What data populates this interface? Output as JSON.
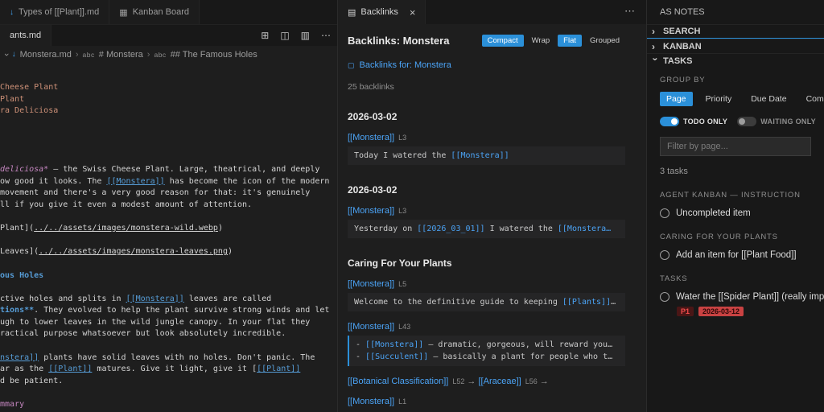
{
  "colors": {
    "accent_blue": "#2b90d9",
    "panel_link_blue": "#4ba3f5",
    "editor_link_blue": "#569cd6",
    "string_orange": "#ce9178",
    "emphasis_pink": "#c586c0",
    "priority_red": "#f14c4c",
    "due_badge_red": "#c94242"
  },
  "icons": {
    "markdown": "↓",
    "board": "▦",
    "backlinks": "▤",
    "note": "▢",
    "close": "×",
    "more": "⋯",
    "chevron": "›",
    "arrow": "→"
  },
  "editor": {
    "tabs_top": [
      {
        "label": "Types of [[Plant]].md",
        "icon": "markdown"
      },
      {
        "label": "Kanban Board",
        "icon": "board"
      }
    ],
    "tab_bottom": "ants.md",
    "actions": [
      {
        "name": "layout-grid-icon",
        "glyph": "⊞"
      },
      {
        "name": "split-editor-icon",
        "glyph": "◫"
      },
      {
        "name": "toggle-panel-icon",
        "glyph": "▥"
      },
      {
        "name": "more-actions-icon",
        "glyph": "⋯"
      }
    ],
    "breadcrumb": {
      "file": "Monstera.md",
      "abc": "abc",
      "symbol1": "# Monstera",
      "symbol2": "## The Famous Holes"
    },
    "lines": [
      {
        "seg": [
          {
            "t": "Cheese Plant",
            "c": "str"
          }
        ]
      },
      {
        "seg": [
          {
            "t": "Plant",
            "c": "str"
          }
        ]
      },
      {
        "seg": [
          {
            "t": "ra Deliciosa",
            "c": "str"
          }
        ]
      },
      {
        "seg": []
      },
      {
        "seg": []
      },
      {
        "seg": []
      },
      {
        "seg": []
      },
      {
        "seg": [
          {
            "t": "deliciosa*",
            "c": "em"
          },
          {
            "t": " — the Swiss Cheese Plant. Large, theatrical, and deeply",
            "c": "txt"
          }
        ]
      },
      {
        "seg": [
          {
            "t": "ow good it looks. The ",
            "c": "txt"
          },
          {
            "t": "[[Monstera]]",
            "c": "link"
          },
          {
            "t": " has become the icon of the modern",
            "c": "txt"
          }
        ]
      },
      {
        "seg": [
          {
            "t": "movement and there's a very good reason for that: it's genuinely",
            "c": "txt"
          }
        ]
      },
      {
        "seg": [
          {
            "t": "ll if you give it even a modest amount of attention.",
            "c": "txt"
          }
        ]
      },
      {
        "seg": []
      },
      {
        "seg": [
          {
            "t": "Plant](",
            "c": "txt"
          },
          {
            "t": "../../assets/images/monstera-wild.webp",
            "c": "url"
          },
          {
            "t": ")",
            "c": "txt"
          }
        ]
      },
      {
        "seg": []
      },
      {
        "seg": [
          {
            "t": "Leaves](",
            "c": "txt"
          },
          {
            "t": "../../assets/images/monstera-leaves.png",
            "c": "url"
          },
          {
            "t": ")",
            "c": "txt"
          }
        ]
      },
      {
        "seg": []
      },
      {
        "seg": [
          {
            "t": "ous Holes",
            "c": "head"
          }
        ]
      },
      {
        "seg": []
      },
      {
        "seg": [
          {
            "t": "ctive holes and splits in ",
            "c": "txt"
          },
          {
            "t": "[[Monstera]]",
            "c": "link"
          },
          {
            "t": " leaves are called",
            "c": "txt"
          }
        ]
      },
      {
        "seg": [
          {
            "t": "tions**",
            "c": "bold"
          },
          {
            "t": ". They evolved to help the plant survive strong winds and let",
            "c": "txt"
          }
        ]
      },
      {
        "seg": [
          {
            "t": "ugh to lower leaves in the wild jungle canopy. In your flat they",
            "c": "txt"
          }
        ]
      },
      {
        "seg": [
          {
            "t": "ractical purpose whatsoever but look absolutely incredible.",
            "c": "txt"
          }
        ]
      },
      {
        "seg": []
      },
      {
        "seg": [
          {
            "t": "nstera]]",
            "c": "link"
          },
          {
            "t": " plants have solid leaves with no holes. Don't panic. The",
            "c": "txt"
          }
        ]
      },
      {
        "seg": [
          {
            "t": "ar as the ",
            "c": "txt"
          },
          {
            "t": "[[Plant]]",
            "c": "link"
          },
          {
            "t": " matures. Give it light, give it ",
            "c": "txt"
          },
          {
            "t": "[",
            "c": "txt"
          },
          {
            "t": "[[Plant]]",
            "c": "link"
          }
        ]
      },
      {
        "seg": [
          {
            "t": "d be patient.",
            "c": "txt"
          }
        ]
      },
      {
        "seg": []
      },
      {
        "seg": [
          {
            "t": "mmary",
            "c": "purple"
          }
        ]
      }
    ]
  },
  "backlinks": {
    "tab_label": "Backlinks",
    "title": "Backlinks: Monstera",
    "view_buttons": [
      {
        "label": "Compact",
        "active": true
      },
      {
        "label": "Wrap",
        "active": false
      },
      {
        "label": "Flat",
        "active": true
      },
      {
        "label": "Grouped",
        "active": false
      }
    ],
    "link_header": "Backlinks for: Monstera",
    "count": "25 backlinks",
    "groups": [
      {
        "header": "2026-03-02",
        "items": [
          {
            "link": "[[Monstera]]",
            "lnum": "L3",
            "code": [
              [
                {
                  "t": "Today I watered the ",
                  "c": "p"
                },
                {
                  "t": "[[Monstera]]",
                  "c": "l"
                }
              ]
            ]
          }
        ]
      },
      {
        "header": "2026-03-02",
        "items": [
          {
            "link": "[[Monstera]]",
            "lnum": "L3",
            "code": [
              [
                {
                  "t": "Yesterday on ",
                  "c": "p"
                },
                {
                  "t": "[[2026_03_01]]",
                  "c": "l"
                },
                {
                  "t": " I watered the ",
                  "c": "p"
                },
                {
                  "t": "[[Monstera…",
                  "c": "l"
                }
              ]
            ]
          }
        ]
      },
      {
        "header": "Caring For Your Plants",
        "items": [
          {
            "link": "[[Monstera]]",
            "lnum": "L5",
            "code": [
              [
                {
                  "t": "Welcome to the definitive guide to keeping ",
                  "c": "p"
                },
                {
                  "t": "[[Plants]]",
                  "c": "l"
                },
                {
                  "t": "…",
                  "c": "p"
                }
              ]
            ]
          },
          {
            "link": "[[Monstera]]",
            "lnum": "L43",
            "accent": true,
            "code": [
              [
                {
                  "t": "- ",
                  "c": "p"
                },
                {
                  "t": "[[Monstera]]",
                  "c": "l"
                },
                {
                  "t": " — dramatic, gorgeous, will reward you…",
                  "c": "p"
                }
              ],
              [
                {
                  "t": "- ",
                  "c": "p"
                },
                {
                  "t": "[[Succulent]]",
                  "c": "l"
                },
                {
                  "t": " — basically a plant for people who t…",
                  "c": "p"
                }
              ]
            ]
          },
          {
            "chain": [
              {
                "link": "[[Botanical Classification]]",
                "lnum": "L52"
              },
              {
                "link": "[[Araceae]]",
                "lnum": "L56"
              }
            ]
          },
          {
            "link": "[[Monstera]]",
            "lnum": "L1"
          }
        ]
      }
    ]
  },
  "sidebar": {
    "title": "AS NOTES",
    "sections": [
      {
        "label": "SEARCH",
        "expanded": false
      },
      {
        "label": "KANBAN",
        "expanded": false
      },
      {
        "label": "TASKS",
        "expanded": true
      }
    ],
    "group_by_label": "GROUP BY",
    "group_buttons": [
      {
        "label": "Page",
        "active": true
      },
      {
        "label": "Priority",
        "active": false
      },
      {
        "label": "Due Date",
        "active": false
      },
      {
        "label": "Completion Date",
        "active": false
      }
    ],
    "toggles": [
      {
        "label": "TODO ONLY",
        "on": true
      },
      {
        "label": "WAITING ONLY",
        "on": false
      }
    ],
    "filter_placeholder": "Filter by page...",
    "task_count": "3 tasks",
    "task_groups": [
      {
        "header": "AGENT KANBAN — INSTRUCTION",
        "tasks": [
          {
            "text": "Uncompleted item"
          }
        ]
      },
      {
        "header": "CARING FOR YOUR PLANTS",
        "tasks": [
          {
            "text": "Add an item for [[Plant Food]]"
          }
        ]
      },
      {
        "header": "TASKS",
        "tasks": [
          {
            "text": "Water the [[Spider Plant]] (really important)",
            "priority": "P1",
            "due": "2026-03-12"
          }
        ]
      }
    ]
  }
}
